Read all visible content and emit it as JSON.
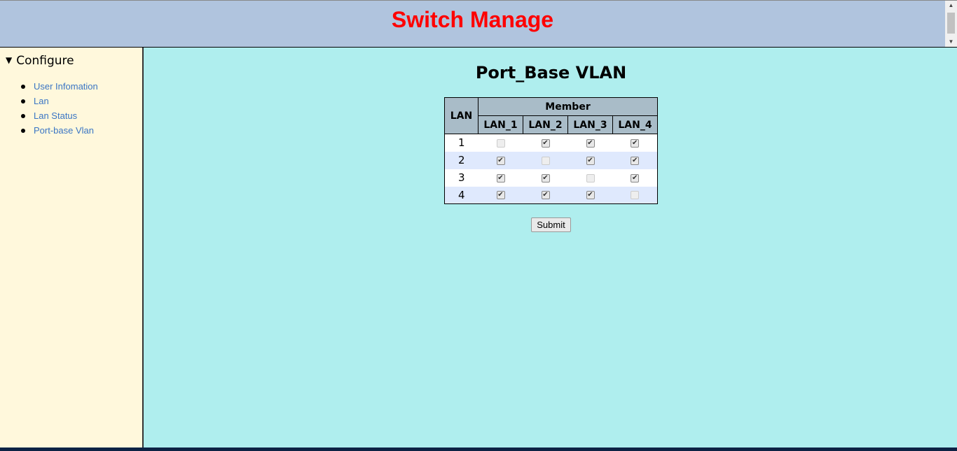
{
  "header": {
    "title": "Switch Manage"
  },
  "sidebar": {
    "section": "Configure",
    "items": [
      {
        "label": "User Infomation"
      },
      {
        "label": "Lan"
      },
      {
        "label": "Lan Status"
      },
      {
        "label": "Port-base Vlan"
      }
    ]
  },
  "main": {
    "title": "Port_Base VLAN",
    "table": {
      "row_header": "LAN",
      "group_header": "Member",
      "columns": [
        "LAN_1",
        "LAN_2",
        "LAN_3",
        "LAN_4"
      ],
      "rows": [
        {
          "lan": "1",
          "members": [
            null,
            true,
            true,
            true
          ]
        },
        {
          "lan": "2",
          "members": [
            true,
            null,
            true,
            true
          ]
        },
        {
          "lan": "3",
          "members": [
            true,
            true,
            null,
            true
          ]
        },
        {
          "lan": "4",
          "members": [
            true,
            true,
            true,
            null
          ]
        }
      ]
    },
    "submit_label": "Submit"
  },
  "colors": {
    "header_bg": "#b0c4de",
    "title": "#ff0000",
    "sidebar_bg": "#fff8dc",
    "main_bg": "#afeeee",
    "link": "#3a75c4"
  }
}
